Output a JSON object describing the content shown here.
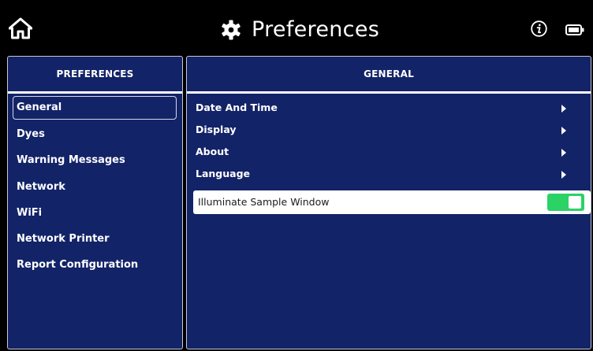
{
  "header": {
    "title": "Preferences",
    "icons": [
      "home-icon",
      "gear-icon",
      "info-icon",
      "battery-icon"
    ]
  },
  "left_panel": {
    "header": "PREFERENCES",
    "items": [
      {
        "label": "General",
        "selected": true
      },
      {
        "label": "Dyes",
        "selected": false
      },
      {
        "label": "Warning Messages",
        "selected": false
      },
      {
        "label": "Network",
        "selected": false
      },
      {
        "label": "WiFi",
        "selected": false
      },
      {
        "label": "Network Printer",
        "selected": false
      },
      {
        "label": "Report Configuration",
        "selected": false
      }
    ]
  },
  "right_panel": {
    "header": "GENERAL",
    "rows": [
      {
        "label": "Date And Time",
        "icon": "chevron-right-icon"
      },
      {
        "label": "Display",
        "icon": "chevron-right-icon"
      },
      {
        "label": "About",
        "icon": "chevron-right-icon"
      },
      {
        "label": "Language",
        "icon": "chevron-right-icon"
      }
    ],
    "toggle_row": {
      "label": "Illuminate Sample Window",
      "enabled": true
    }
  },
  "colors": {
    "background": "#000000",
    "panel": "#132368",
    "toggle_on": "#2bd266",
    "text": "#ffffff"
  }
}
